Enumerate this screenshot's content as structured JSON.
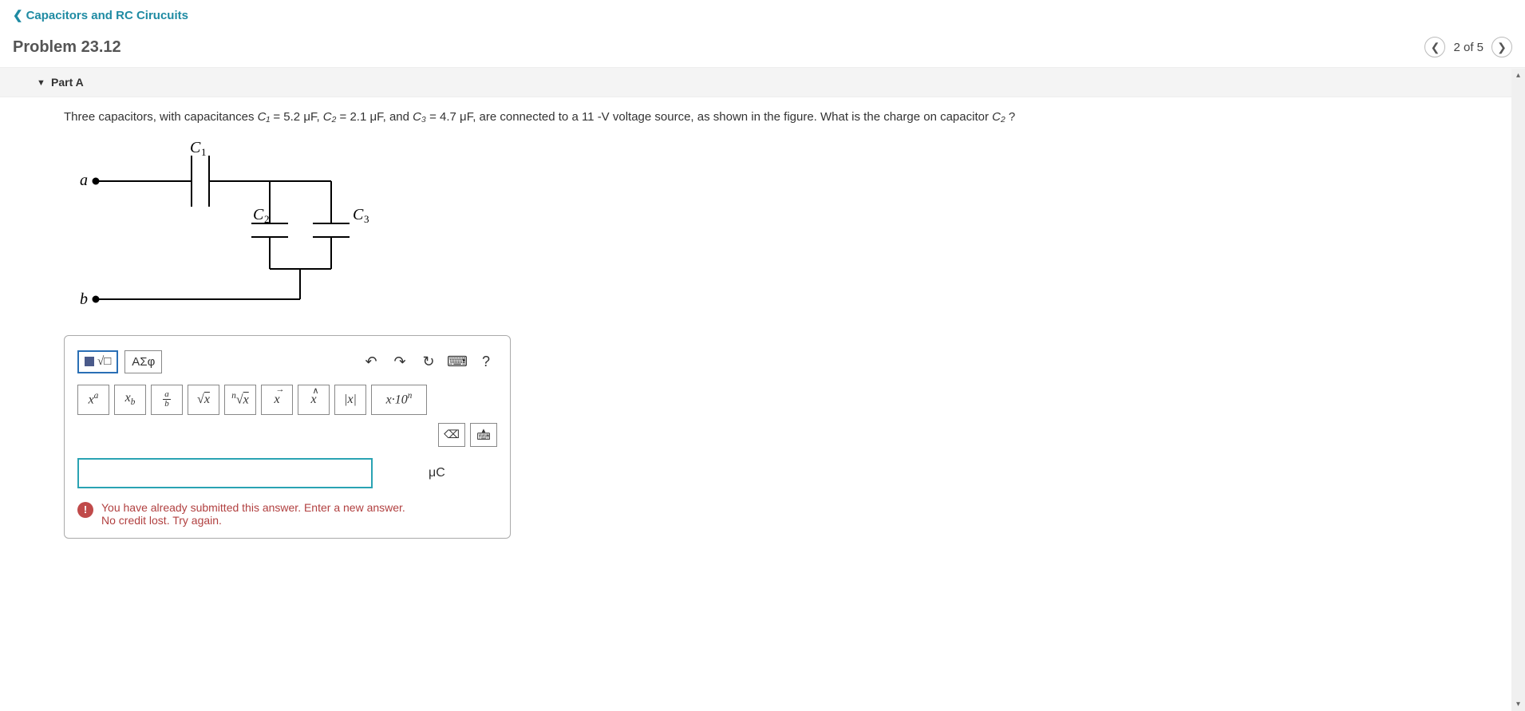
{
  "breadcrumb": {
    "chev": "❮",
    "label": "Capacitors and RC Cirucuits"
  },
  "header": {
    "title": "Problem 23.12",
    "counter": "2 of 5"
  },
  "part": {
    "label": "Part A"
  },
  "question": {
    "pre": "Three capacitors, with capacitances ",
    "c1": "C₁",
    "c1val": " = 5.2 μF, ",
    "c2": "C₂",
    "c2val": " = 2.1 μF, and ",
    "c3": "C₃",
    "c3val": " = 4.7 μF, are connected to a 11 -V voltage source, as shown in the figure. What is the charge on capacitor ",
    "cq": "C₂",
    "post": " ?"
  },
  "figure": {
    "a": "a",
    "b": "b",
    "C1": "C₁",
    "C2": "C₂",
    "C3": "C₃"
  },
  "toolbar": {
    "tab2": "ΑΣφ",
    "undo": "↶",
    "redo": "↷",
    "reset": "↻",
    "keyboard": "⌨",
    "help": "?",
    "sym_xa": "xᵃ",
    "sym_xb": "xᵦ",
    "sym_sqrt": "√x",
    "sym_nroot": "ⁿ√x",
    "sym_vec": "x→",
    "sym_hat": "x̂",
    "sym_abs": "|x|",
    "sym_sci": "x·10ⁿ",
    "backspace": "⌫",
    "kbd2": "⌨"
  },
  "answer": {
    "value": "",
    "unit": "μC"
  },
  "feedback": {
    "line1": "You have already submitted this answer. Enter a new answer.",
    "line2": "No credit lost. Try again."
  }
}
